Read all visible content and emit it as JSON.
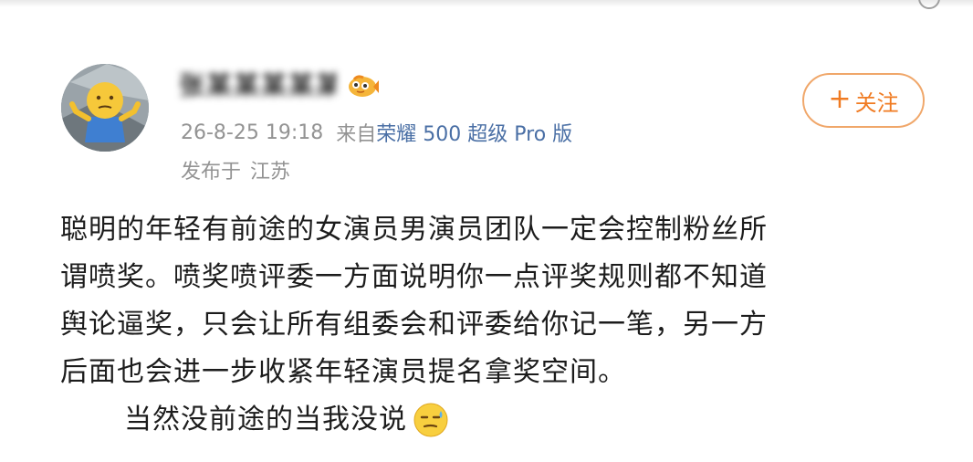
{
  "author": {
    "name": "张某某某某某",
    "vip_badge_icon": "vip-fish-icon",
    "avatar_icon": "shrug-emoji-avatar"
  },
  "meta": {
    "date_time": "26-8-25 19:18",
    "source_prefix": "来自",
    "source_device": "荣耀 500 超级 Pro 版",
    "location_label": "发布于",
    "location": "江苏"
  },
  "follow_button": {
    "plus": "+",
    "label": "关注"
  },
  "post": {
    "lines": [
      "聪明的年轻有前途的女演员男演员团队一定会控制粉丝所",
      "谓喷奖。喷奖喷评委一方面说明你一点评奖规则都不知道",
      "舆论逼奖，只会让所有组委会和评委给你记一笔，另一方",
      "后面也会进一步收紧年轻演员提名拿奖空间。",
      "当然没前途的当我没说"
    ],
    "trailing_emoji": "sweat-smile-emoji"
  },
  "colors": {
    "accent_orange": "#f07b22",
    "follow_border": "#f0a76a",
    "source_link": "#4a6fa5",
    "meta_gray": "#939393",
    "body_text": "#1c1c1c"
  }
}
